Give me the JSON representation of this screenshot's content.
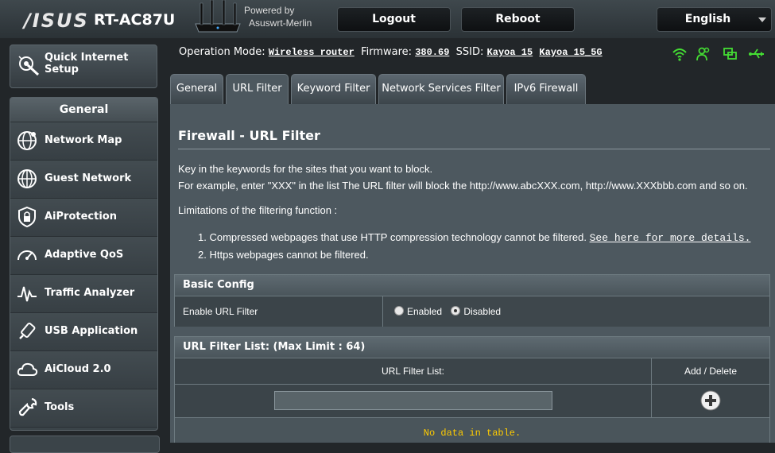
{
  "header": {
    "logo": "/ISUS",
    "model": "RT-AC87U",
    "powered_by_line1": "Powered by",
    "powered_by_line2": "Asuswrt-Merlin",
    "logout_label": "Logout",
    "reboot_label": "Reboot",
    "language": "English"
  },
  "sidebar": {
    "quick_setup_label": "Quick Internet\nSetup",
    "menu_title": "General",
    "items": [
      {
        "label": "Network Map",
        "icon": "network-map-icon"
      },
      {
        "label": "Guest Network",
        "icon": "globe-icon"
      },
      {
        "label": "AiProtection",
        "icon": "shield-lock-icon"
      },
      {
        "label": "Adaptive QoS",
        "icon": "speedometer-icon"
      },
      {
        "label": "Traffic Analyzer",
        "icon": "traffic-analyzer-icon"
      },
      {
        "label": "USB Application",
        "icon": "usb-icon"
      },
      {
        "label": "AiCloud 2.0",
        "icon": "cloud-icon"
      },
      {
        "label": "Tools",
        "icon": "wrench-icon"
      }
    ]
  },
  "status": {
    "operation_mode_label": "Operation Mode:",
    "operation_mode": "Wireless router",
    "firmware_label": "Firmware:",
    "firmware": "380.69",
    "ssid_label": "SSID:",
    "ssid_1": "Kayoa 15",
    "ssid_2": "Kayoa 15_5G",
    "icons": [
      "wifi-icon",
      "users-icon",
      "network-icon",
      "usb-icon"
    ],
    "icon_color": "#44dd33"
  },
  "tabs": [
    {
      "label": "General",
      "active": false
    },
    {
      "label": "URL Filter",
      "active": true
    },
    {
      "label": "Keyword Filter",
      "active": false
    },
    {
      "label": "Network Services Filter",
      "active": false
    },
    {
      "label": "IPv6 Firewall",
      "active": false
    }
  ],
  "content": {
    "title": "Firewall - URL Filter",
    "desc_1": "Key in the keywords for the sites that you want to block.",
    "desc_2": "For example, enter \"XXX\" in the list The URL filter will block the http://www.abcXXX.com, http://www.XXXbbb.com and so on.",
    "limits_title": "Limitations of the filtering function :",
    "limit_1": "1. Compressed webpages that use HTTP compression technology cannot be filtered.",
    "limit_1_link": "See here for more details.",
    "limit_2": "2. Https webpages cannot be filtered."
  },
  "basic_config": {
    "heading": "Basic Config",
    "enable_label": "Enable URL Filter",
    "option_enabled": "Enabled",
    "option_disabled": "Disabled",
    "selected": "Disabled"
  },
  "filter_list": {
    "heading": "URL Filter List: (Max Limit : 64)",
    "col_list": "URL Filter List:",
    "col_add": "Add / Delete",
    "input_value": "",
    "empty_text": "No data in table."
  }
}
